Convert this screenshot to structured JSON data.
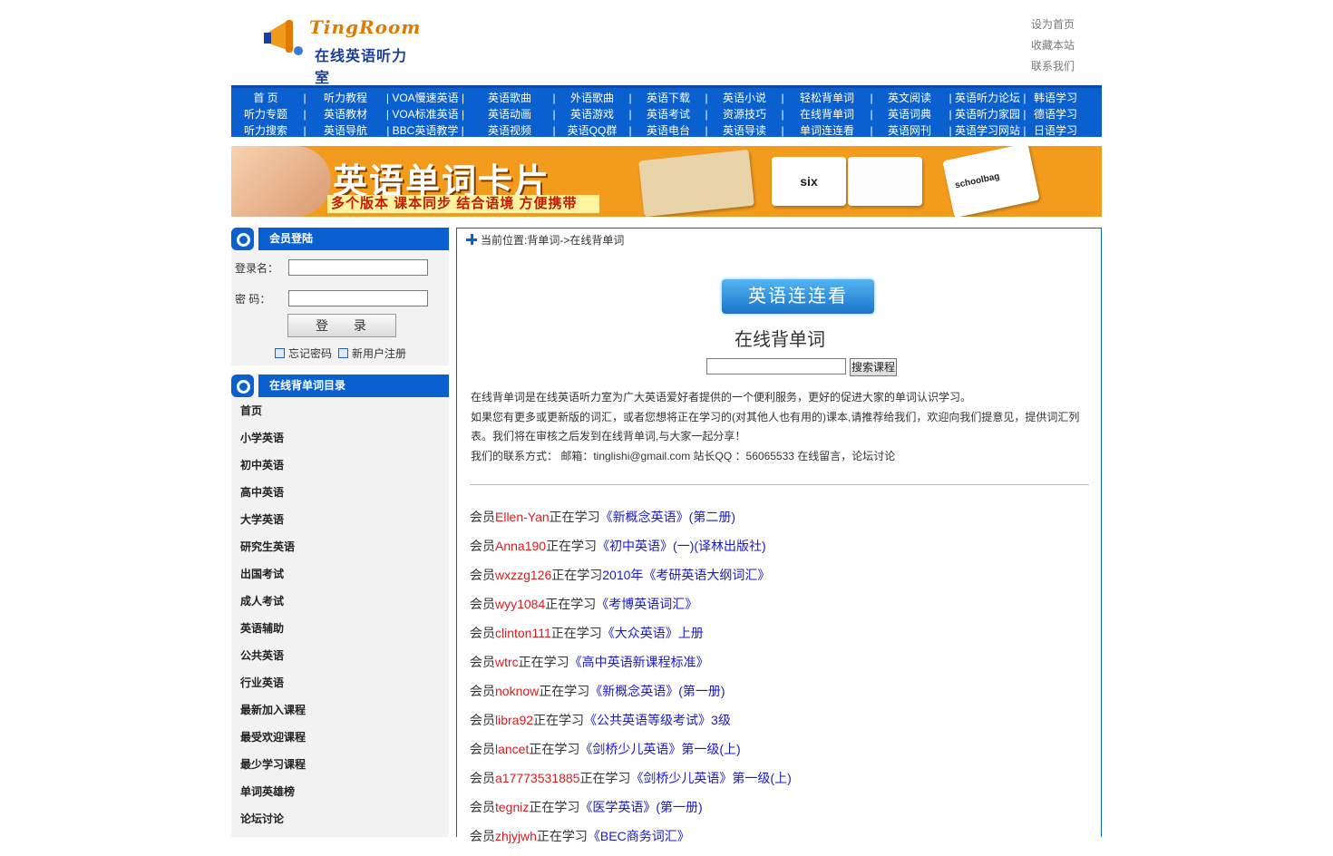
{
  "header": {
    "logo_en": "TingRoom",
    "logo_cn": "在线英语听力室",
    "links": [
      "设为首页",
      "收藏本站",
      "联系我们"
    ]
  },
  "nav": {
    "rows": [
      [
        "首 页",
        "|",
        "听力教程",
        "| VOA慢速英语 |",
        "英语歌曲",
        "|",
        "外语歌曲",
        "|",
        "英语下载",
        "|",
        "英语小说",
        "|",
        "轻松背单词",
        "|",
        "英文阅读",
        "| 英语听力论坛 |",
        "韩语学习"
      ],
      [
        "听力专题",
        "|",
        "英语教材",
        "| VOA标准英语 |",
        "英语动画",
        "|",
        "英语游戏",
        "|",
        "英语考试",
        "|",
        "资源技巧",
        "|",
        "在线背单词",
        "|",
        "英语词典",
        "| 英语听力家园 |",
        "德语学习"
      ],
      [
        "听力搜索",
        "|",
        "英语导航",
        "| BBC英语教学 |",
        "英语视频",
        "|",
        "英语QQ群",
        "|",
        "英语电台",
        "|",
        "英语导读",
        "|",
        "单词连连看",
        "|",
        "英语网刊",
        "| 英语学习网站 |",
        "日语学习"
      ]
    ]
  },
  "banner": {
    "title": "英语单词卡片",
    "subtitle": "多个版本 课本同步 结合语境 方便携带",
    "card_word_1": "six",
    "card_word_2": "schoolbag"
  },
  "login": {
    "heading": "会员登陆",
    "username_label": "登录名：",
    "password_label": "密  码：",
    "username_value": "",
    "password_value": "",
    "submit_label": "登 录",
    "forgot_label": "忘记密码",
    "register_label": "新用户注册"
  },
  "catalog": {
    "heading": "在线背单词目录",
    "items": [
      "首页",
      "小学英语",
      "初中英语",
      "高中英语",
      "大学英语",
      "研究生英语",
      "出国考试",
      "成人考试",
      "英语辅助",
      "公共英语",
      "行业英语",
      "最新加入课程",
      "最受欢迎课程",
      "最少学习课程",
      "单词英雄榜",
      "论坛讨论"
    ]
  },
  "main": {
    "breadcrumb": "当前位置:背单词->在线背单词",
    "badge": "英语连连看",
    "title": "在线背单词",
    "search_value": "",
    "search_button": "搜索课程",
    "intro": [
      "在线背单词是在线英语听力室为广大英语爱好者提供的一个便利服务，更好的促进大家的单词认识学习。",
      "如果您有更多或更新版的词汇，或者您想将正在学习的(对其他人也有用的)课本,请推荐给我们，欢迎向我们提意见，提供词汇列表。我们将在审核之后发到在线背单词,与大家一起分享！",
      "我们的联系方式： 邮箱：tinglishi@gmail.com 站长QQ ：56065533 在线留言，论坛讨论"
    ],
    "feed_prefix": "会员",
    "feed_mid": "正在学习",
    "feed": [
      {
        "user": "Ellen-Yan",
        "course": "《新概念英语》(第二册)"
      },
      {
        "user": "Anna190",
        "course": "《初中英语》(一)(译林出版社)"
      },
      {
        "user": "wxzzg126",
        "course": "2010年《考研英语大纲词汇》"
      },
      {
        "user": "wyy1084",
        "course": "《考博英语词汇》"
      },
      {
        "user": "clinton111",
        "course": "《大众英语》上册"
      },
      {
        "user": "wtrc",
        "course": "《高中英语新课程标准》"
      },
      {
        "user": "noknow",
        "course": "《新概念英语》(第一册)"
      },
      {
        "user": "libra92",
        "course": "《公共英语等级考试》3级"
      },
      {
        "user": "lancet",
        "course": "《剑桥少儿英语》第一级(上)"
      },
      {
        "user": "a17773531885",
        "course": "《剑桥少儿英语》第一级(上)"
      },
      {
        "user": "tegniz",
        "course": "《医学英语》(第一册)"
      },
      {
        "user": "zhjyjwh",
        "course": "《BEC商务词汇》"
      }
    ]
  },
  "colors": {
    "nav_blue": "#0a60cf",
    "user_red": "#d91c1c",
    "course_blue": "#1a1ac8",
    "banner_orange": "#f39b1c"
  }
}
